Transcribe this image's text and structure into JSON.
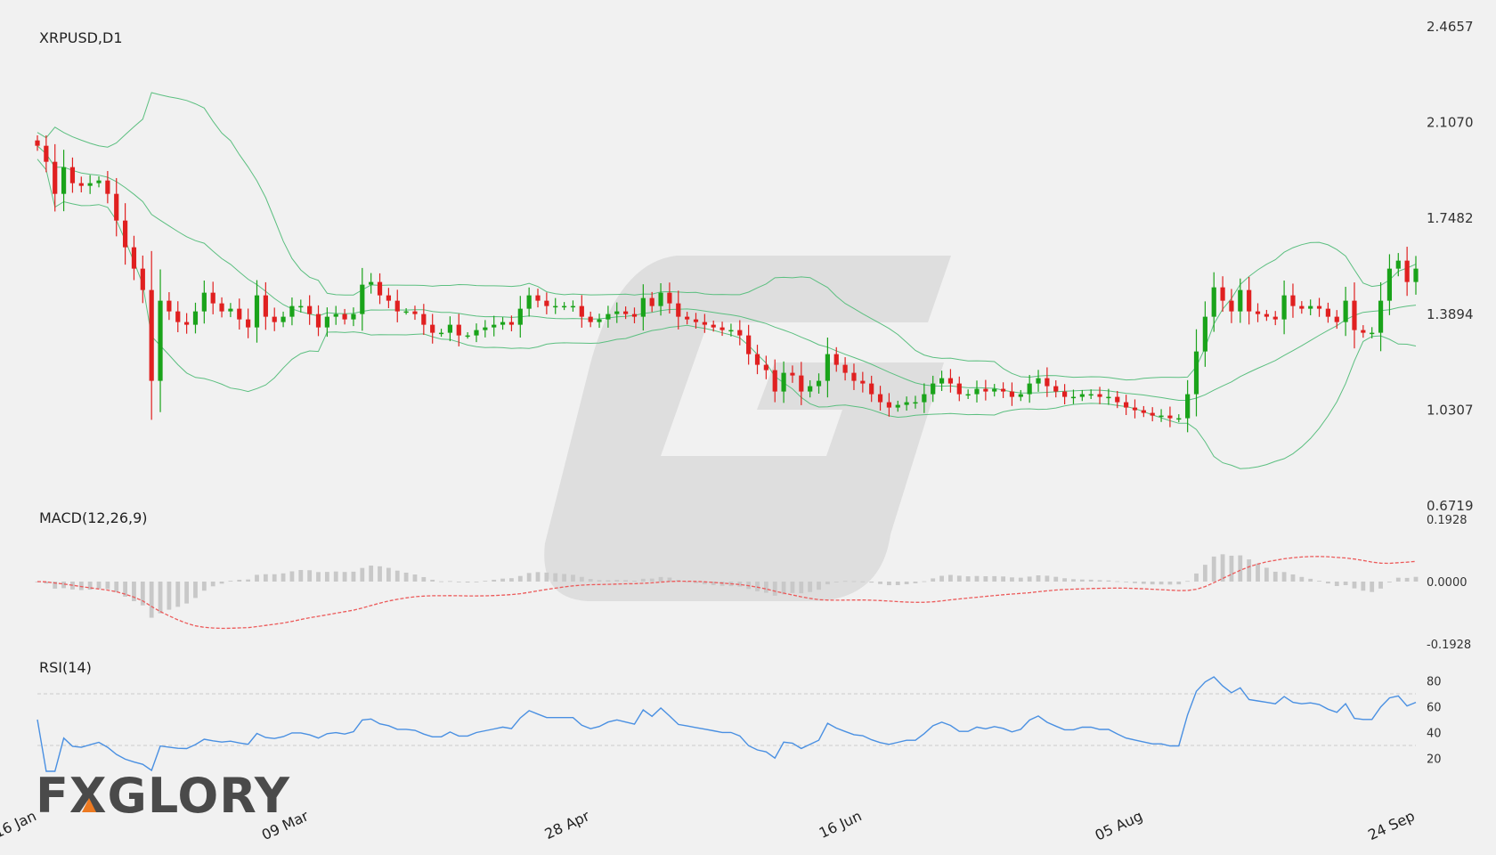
{
  "chart_data": {
    "type": "candlestick",
    "title": "XRPUSD,D1",
    "x_ticks": [
      "16 Jan",
      "09 Mar",
      "28 Apr",
      "16 Jun",
      "05 Aug",
      "24 Sep"
    ],
    "price_panel": {
      "y_ticks": [
        "2.4657",
        "2.1070",
        "1.7482",
        "1.3894",
        "1.0307",
        "0.6719"
      ],
      "ylim": [
        0.6719,
        2.4657
      ],
      "series": {
        "close": [
          2.02,
          1.96,
          1.84,
          1.94,
          1.88,
          1.87,
          1.88,
          1.89,
          1.84,
          1.74,
          1.64,
          1.56,
          1.48,
          1.14,
          1.44,
          1.4,
          1.36,
          1.35,
          1.4,
          1.47,
          1.43,
          1.4,
          1.41,
          1.37,
          1.34,
          1.46,
          1.38,
          1.36,
          1.38,
          1.42,
          1.42,
          1.39,
          1.34,
          1.38,
          1.39,
          1.37,
          1.39,
          1.5,
          1.51,
          1.46,
          1.44,
          1.4,
          1.4,
          1.39,
          1.35,
          1.32,
          1.32,
          1.35,
          1.31,
          1.31,
          1.33,
          1.34,
          1.35,
          1.36,
          1.35,
          1.41,
          1.46,
          1.44,
          1.42,
          1.42,
          1.42,
          1.42,
          1.38,
          1.36,
          1.37,
          1.39,
          1.4,
          1.39,
          1.38,
          1.45,
          1.42,
          1.47,
          1.43,
          1.38,
          1.37,
          1.36,
          1.35,
          1.34,
          1.33,
          1.33,
          1.31,
          1.24,
          1.2,
          1.18,
          1.1,
          1.17,
          1.16,
          1.1,
          1.12,
          1.14,
          1.24,
          1.2,
          1.17,
          1.14,
          1.13,
          1.09,
          1.06,
          1.04,
          1.05,
          1.06,
          1.06,
          1.09,
          1.13,
          1.15,
          1.13,
          1.09,
          1.09,
          1.11,
          1.1,
          1.11,
          1.1,
          1.08,
          1.09,
          1.13,
          1.15,
          1.12,
          1.1,
          1.08,
          1.08,
          1.09,
          1.09,
          1.08,
          1.08,
          1.06,
          1.04,
          1.03,
          1.02,
          1.01,
          1.01,
          1.0,
          1.0,
          1.09,
          1.25,
          1.38,
          1.49,
          1.44,
          1.4,
          1.48,
          1.4,
          1.39,
          1.38,
          1.37,
          1.46,
          1.42,
          1.41,
          1.42,
          1.41,
          1.38,
          1.36,
          1.44,
          1.33,
          1.32,
          1.32,
          1.44,
          1.56,
          1.59,
          1.51,
          1.56
        ]
      },
      "candle_count": 156,
      "bollinger": {
        "period": 20,
        "stddev": 2
      }
    },
    "macd_panel": {
      "label": "MACD(12,26,9)",
      "y_ticks": [
        "0.1928",
        "0.0000",
        "-0.1928"
      ],
      "ylim": [
        -0.1928,
        0.1928
      ]
    },
    "rsi_panel": {
      "label": "RSI(14)",
      "y_ticks": [
        "80",
        "60",
        "40",
        "20"
      ],
      "ylim": [
        10,
        90
      ],
      "levels": [
        70,
        30
      ]
    },
    "colors": {
      "up": "#1aa31a",
      "down": "#e02020",
      "band": "#5cbf80",
      "macd_hist": "#c8c8c8",
      "macd_signal": "#ec5a5a",
      "rsi_line": "#4a90e2",
      "level_line": "#cccccc"
    }
  },
  "brand": {
    "logo_text": "FXGLORY",
    "logo_accent": "#ec7a22"
  }
}
